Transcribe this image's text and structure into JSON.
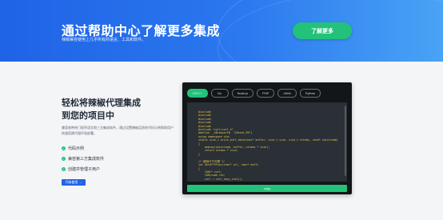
{
  "hero": {
    "title": "通过帮助中心了解更多集成",
    "subtitle": "辣椒兼容使用上几乎所有的语言、工具和软件。",
    "button": "了解更多"
  },
  "left": {
    "title_line1": "轻松将辣椒代理集成",
    "title_line2": "到您的项目中",
    "description": "兼容各种热门程序语言和三方集成软件，通过设置辣椒品质的代码示例帮助用户快速搭建代理环境部署。",
    "features": [
      "代码示例",
      "兼容第三方集成软件",
      "创建并管理子用户"
    ],
    "start_button": "开始使用 →"
  },
  "code_panel": {
    "tabs": [
      "C/C++",
      "Go",
      "Node.js",
      "PHP",
      "JAVA",
      "Python"
    ],
    "active_tab": 0,
    "code": "#include\n#include\n#include\n#include\n#include\n#include \"curl/curl.h\"\n#define  _kBrowserFN  \"[Reset_FN\"]\nusing namespace std;\nstatic size_t write_buff_data(char* buffer, size_t size, size_t nitems, void* outstream)\n{\n    memcpy(outstream, buffer, nitems * size);\n    return nitems * size;\n}\n\n/* 使用HTTP代理 */\nint GetHTTPFunc(char* url, char* buff)\n{\n    CURL* curl;\n    CURLcode res;\n    curl = curl_easy_init();",
    "copy_button": "copy"
  }
}
